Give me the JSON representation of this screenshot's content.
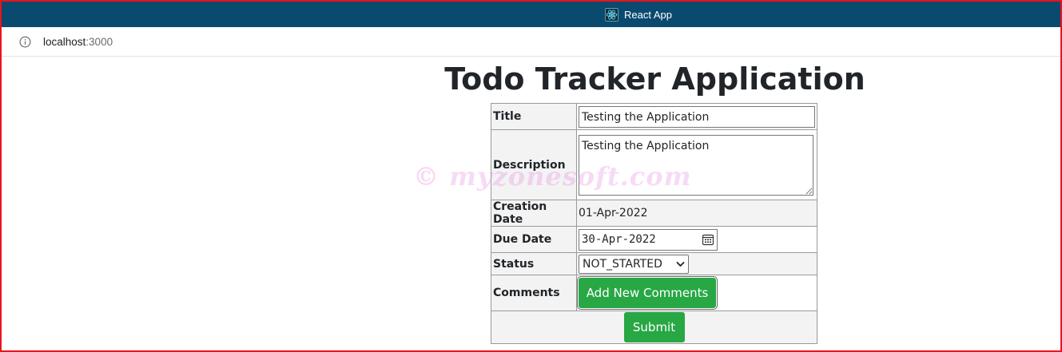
{
  "browser": {
    "tab_title": "React App",
    "url_host": "localhost",
    "url_port": ":3000"
  },
  "page": {
    "title": "Todo Tracker Application"
  },
  "form": {
    "title_label": "Title",
    "title_value": "Testing the Application",
    "description_label": "Description",
    "description_value": "Testing the Application",
    "creation_date_label": "Creation Date",
    "creation_date_value": "01-Apr-2022",
    "due_date_label": "Due Date",
    "due_date_value": "30-Apr-2022",
    "status_label": "Status",
    "status_value": "NOT_STARTED",
    "comments_label": "Comments",
    "add_comments_label": "Add New Comments",
    "submit_label": "Submit"
  },
  "watermark": "© myzonesoft.com",
  "colors": {
    "titlebar": "#0b4a6f",
    "button_green": "#28a745",
    "frame_border": "#e8141d"
  },
  "icons": [
    "react-logo-icon",
    "info-icon",
    "calendar-icon",
    "chevron-down-icon"
  ]
}
